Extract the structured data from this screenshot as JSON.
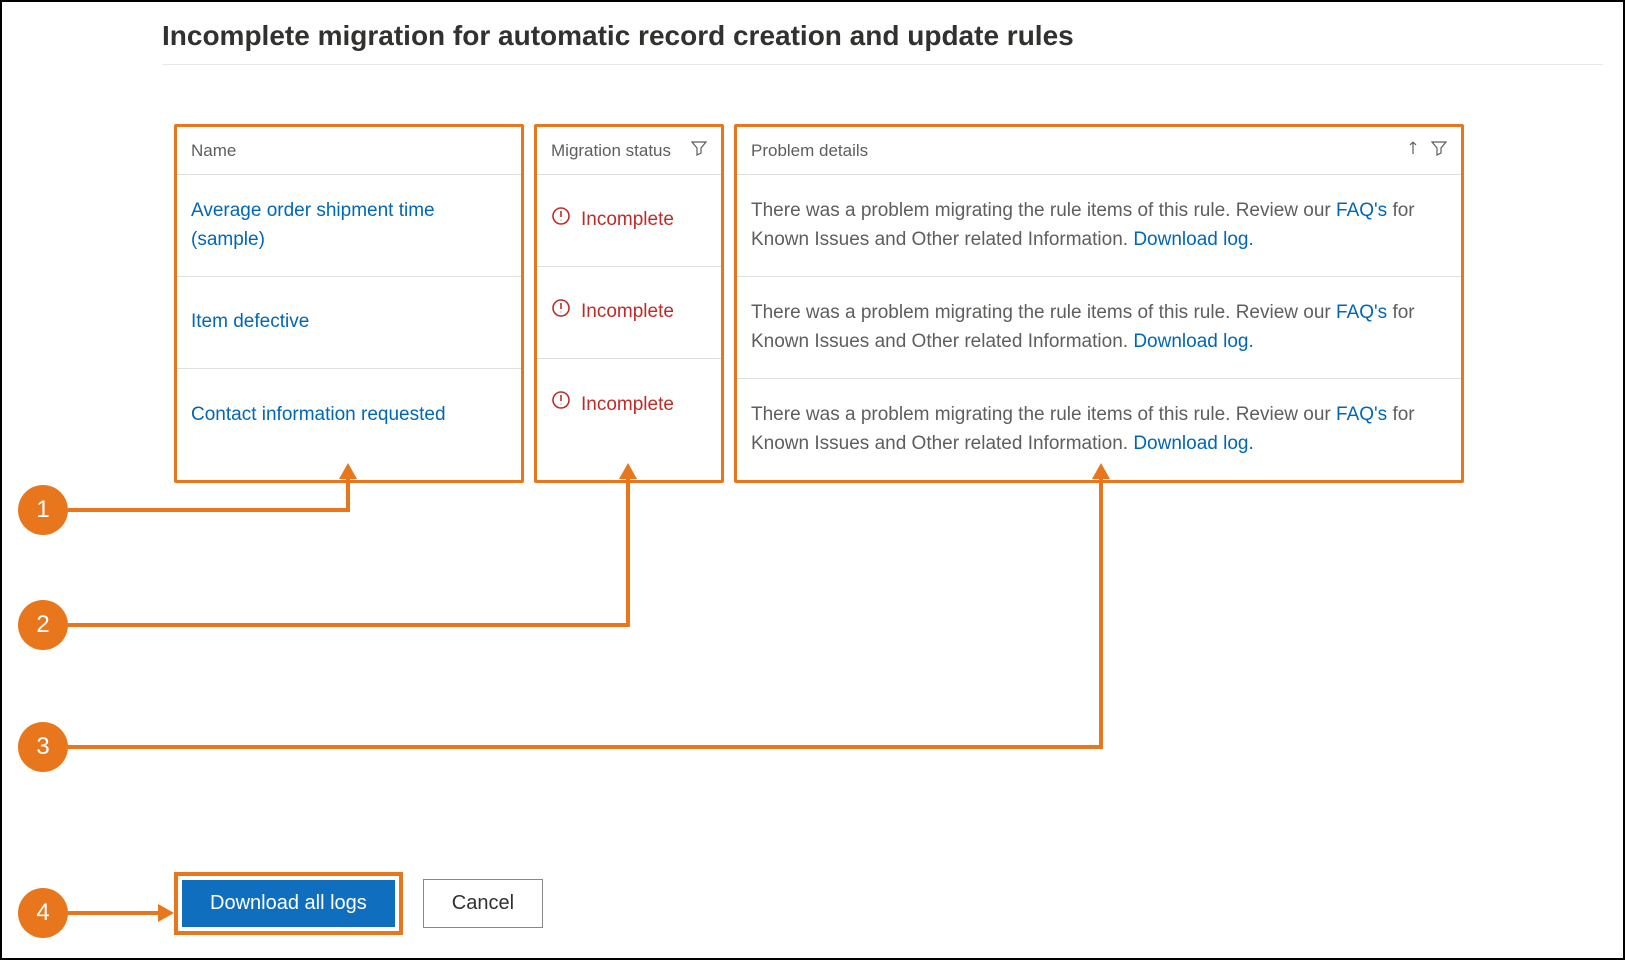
{
  "page": {
    "title": "Incomplete migration for automatic record creation and update rules"
  },
  "columns": {
    "name_header": "Name",
    "status_header": "Migration status",
    "problem_header": "Problem details"
  },
  "status_label": "Incomplete",
  "problem_template": {
    "prefix": "There was a problem migrating the rule items of this rule. Review our ",
    "faqs_link": "FAQ's",
    "middle": " for Known Issues and Other related Information. ",
    "download_link": "Download log."
  },
  "rows": [
    {
      "name": "Average order shipment time (sample)"
    },
    {
      "name": "Item defective"
    },
    {
      "name": "Contact information requested"
    }
  ],
  "buttons": {
    "download_all": "Download all logs",
    "cancel": "Cancel"
  },
  "callouts": [
    "1",
    "2",
    "3",
    "4"
  ],
  "icons": {
    "filter": "filter-icon",
    "sort": "sort-icon",
    "warn": "warning-icon"
  }
}
